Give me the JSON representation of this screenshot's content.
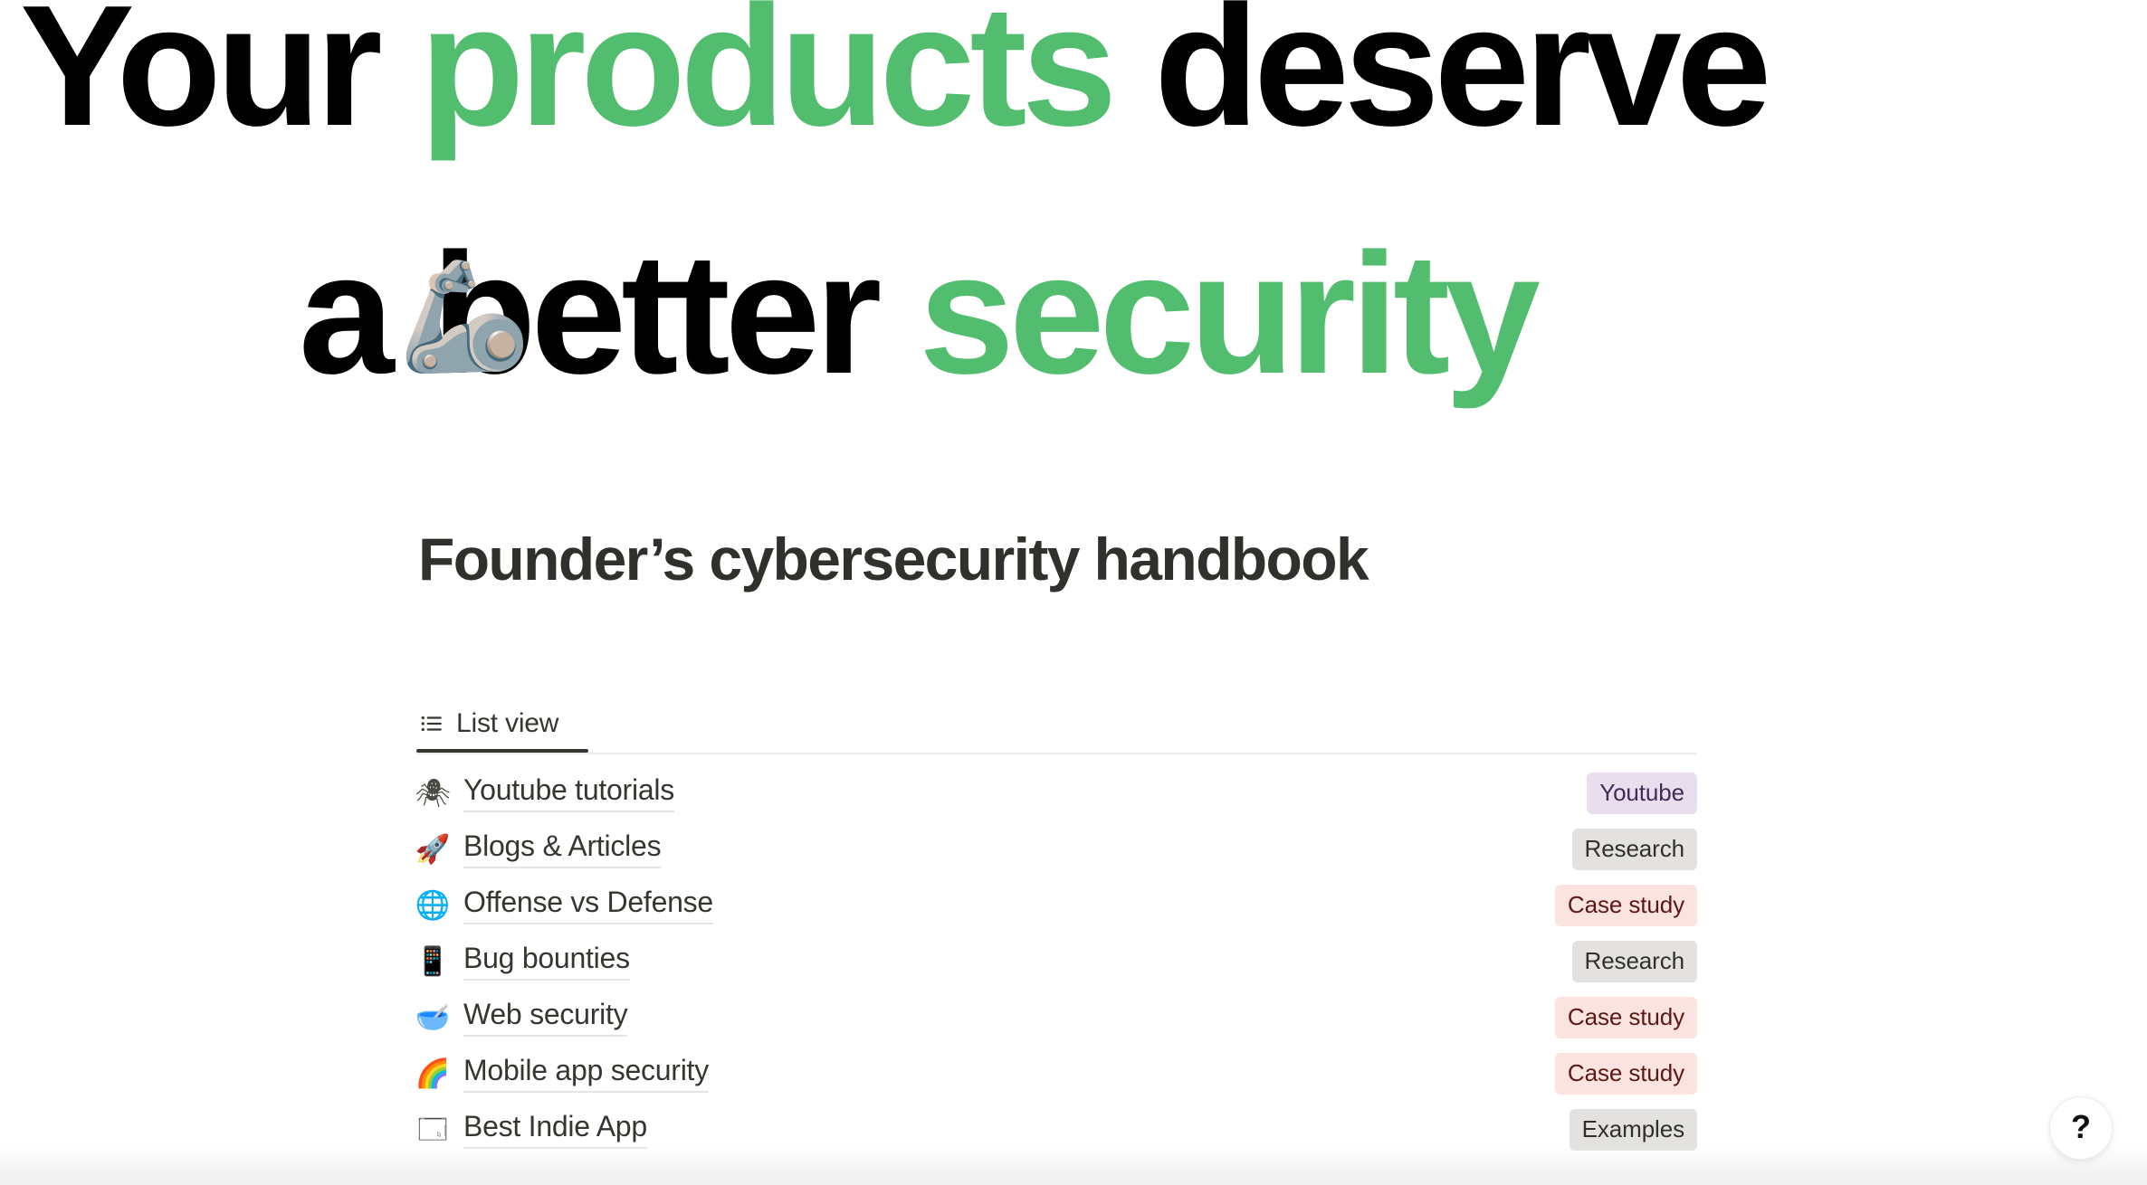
{
  "hero": {
    "line1": [
      {
        "text": "Your ",
        "accent": false
      },
      {
        "text": "products",
        "accent": true
      },
      {
        "text": " deserve",
        "accent": false
      }
    ],
    "line2": [
      {
        "text": "a better ",
        "accent": false
      },
      {
        "text": "security",
        "accent": true
      }
    ],
    "line1_plain": "Your products deserve",
    "line2_plain": "a better security",
    "emoji": "🦾",
    "emoji_name": "mechanical-arm-emoji",
    "accent_color": "#52BD6F",
    "text_color": "#000000"
  },
  "page": {
    "title": "Founder’s cybersecurity handbook",
    "title_color": "#32302c",
    "background": "#ffffff"
  },
  "collection": {
    "tabs": [
      {
        "label": "List view",
        "icon": "list-view-icon",
        "active": true
      }
    ],
    "rows": [
      {
        "icon": "🕷",
        "icon_name": "spider-icon",
        "title": "Youtube tutorials",
        "tag": "Youtube",
        "tag_style": "tag-purple"
      },
      {
        "icon": "🚀",
        "icon_name": "rocket-icon",
        "title": "Blogs & Articles",
        "tag": "Research",
        "tag_style": "tag-gray"
      },
      {
        "icon": "🌐",
        "icon_name": "globe-icon",
        "title": "Offense vs Defense",
        "tag": "Case study",
        "tag_style": "tag-red"
      },
      {
        "icon": "📱",
        "icon_name": "mobile-phone-icon",
        "title": "Bug bounties",
        "tag": "Research",
        "tag_style": "tag-gray"
      },
      {
        "icon": "🥣",
        "icon_name": "bowl-icon",
        "title": "Web security",
        "tag": "Case study",
        "tag_style": "tag-red"
      },
      {
        "icon": "🌈",
        "icon_name": "fingerprint-icon",
        "title": "Mobile app security",
        "tag": "Case study",
        "tag_style": "tag-red"
      },
      {
        "icon": "🗔",
        "icon_name": "window-icon",
        "title": "Best Indie App",
        "tag": "Examples",
        "tag_style": "tag-gray"
      }
    ]
  },
  "help": {
    "label": "?",
    "name": "help-button"
  },
  "colors": {
    "accent_green": "#52BD6F",
    "tag_purple_bg": "#e8deee",
    "tag_purple_fg": "#442a55",
    "tag_gray_bg": "#e3e2e0",
    "tag_gray_fg": "#32302c",
    "tag_red_bg": "#fbe4e0",
    "tag_red_fg": "#5d1715",
    "tab_underline": "#37352f",
    "divider": "#ececeb"
  }
}
